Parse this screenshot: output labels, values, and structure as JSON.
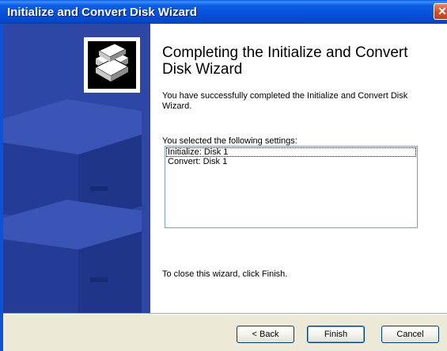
{
  "window": {
    "title": "Initialize and Convert Disk Wizard",
    "close_glyph": "✕"
  },
  "icons": {
    "sidebar": "stacked-disks-icon",
    "close": "close-icon"
  },
  "colors": {
    "title_bar": "#0551d8",
    "sidebar": "#2e46a5",
    "content_bg": "#ffffff",
    "dialog_bg": "#ece9d8"
  },
  "content": {
    "heading": "Completing the Initialize and Convert Disk Wizard",
    "intro": "You have successfully completed the Initialize and Convert Disk Wizard.",
    "settings_label": "You selected the following settings:",
    "settings": [
      "Initialize: Disk 1",
      "Convert: Disk 1"
    ],
    "close_note": "To close this wizard, click Finish."
  },
  "buttons": {
    "back": "< Back",
    "finish": "Finish",
    "cancel": "Cancel"
  }
}
